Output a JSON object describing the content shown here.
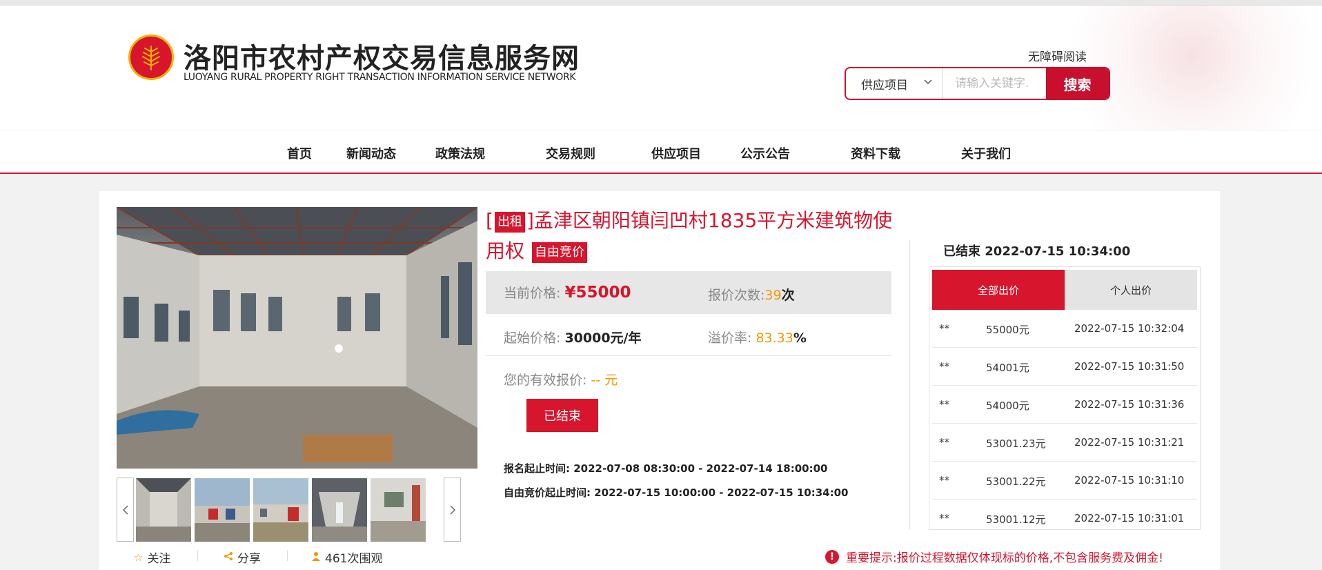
{
  "colors": {
    "brand": "#d7152d",
    "accent": "#f39800",
    "gray_box": "#e7e7e7"
  },
  "header": {
    "site_title": "洛阳市农村产权交易信息服务网",
    "site_subtitle": "LUOYANG RURAL PROPERTY RIGHT TRANSACTION INFORMATION SERVICE NETWORK",
    "accessibility": "无障碍阅读",
    "search": {
      "category": "供应项目",
      "placeholder": "请输入关键字.",
      "button": "搜索"
    }
  },
  "nav": {
    "items": [
      "首页",
      "新闻动态",
      "政策法规",
      "交易规则",
      "供应项目",
      "公示公告",
      "资料下载",
      "关于我们"
    ]
  },
  "gallery": {
    "prev_icon": "chevron-left-icon",
    "next_icon": "chevron-right-icon"
  },
  "social": {
    "follow": "关注",
    "share": "分享",
    "views": "461次围观"
  },
  "listing": {
    "type_tag": "出租",
    "title": "孟津区朝阳镇闫凹村1835平方米建筑物使用权",
    "mode_tag": "自由竞价",
    "bracket_open": "[",
    "bracket_close": "]"
  },
  "pricing": {
    "current_price_label": "当前价格:",
    "current_price_value": "¥55000",
    "bid_count_label": "报价次数:",
    "bid_count_value": "39",
    "bid_count_unit": "次",
    "start_price_label": "起始价格:",
    "start_price_value": "30000元/年",
    "premium_label": "溢价率:",
    "premium_value": "83.33",
    "premium_unit": "%",
    "your_bid_label": "您的有效报价:",
    "your_bid_value": "-- 元",
    "ended_button": "已结束"
  },
  "times": {
    "signup": "报名起止时间: 2022-07-08 08:30:00 - 2022-07-14 18:00:00",
    "bidding": "自由竞价起止时间: 2022-07-15 10:00:00 - 2022-07-15 10:34:00"
  },
  "bids": {
    "status": "已结束 2022-07-15 10:34:00",
    "tabs": [
      "全部出价",
      "个人出价"
    ],
    "rows": [
      {
        "user": "**",
        "amount": "55000元",
        "time": "2022-07-15 10:32:04"
      },
      {
        "user": "**",
        "amount": "54001元",
        "time": "2022-07-15 10:31:50"
      },
      {
        "user": "**",
        "amount": "54000元",
        "time": "2022-07-15 10:31:36"
      },
      {
        "user": "**",
        "amount": "53001.23元",
        "time": "2022-07-15 10:31:21"
      },
      {
        "user": "**",
        "amount": "53001.22元",
        "time": "2022-07-15 10:31:10"
      },
      {
        "user": "**",
        "amount": "53001.12元",
        "time": "2022-07-15 10:31:01"
      }
    ]
  },
  "notice": "重要提示:报价过程数据仅体现标的价格,不包含服务费及佣金!"
}
